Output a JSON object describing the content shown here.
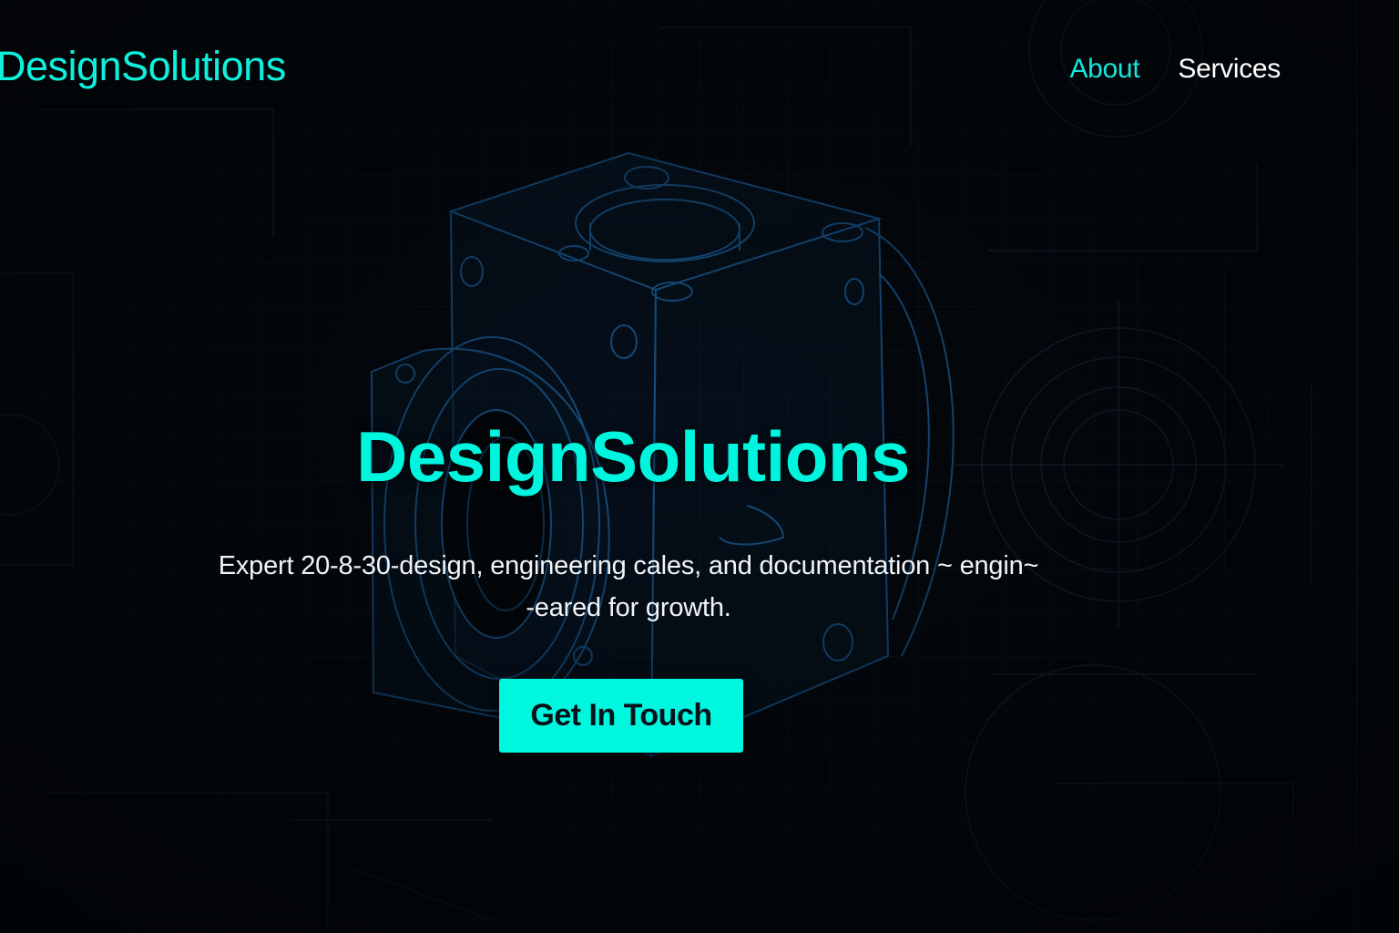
{
  "header": {
    "logo": "DesignSolutions",
    "nav": [
      {
        "label": "About",
        "active": true
      },
      {
        "label": "Services",
        "active": false
      }
    ]
  },
  "hero": {
    "title": "DesignSolutions",
    "subtitle_line1": "Expert 20-8-30-design, engineering cales, and documentation ~ engin~",
    "subtitle_line2": "-eared for growth.",
    "cta_label": "Get In Touch"
  },
  "colors": {
    "accent": "#00f5df",
    "background": "#03070c",
    "text": "#ffffff",
    "wireframe": "#1c5f9a"
  },
  "icons": {
    "hero_graphic": "mechanical-valve-block-wireframe"
  }
}
